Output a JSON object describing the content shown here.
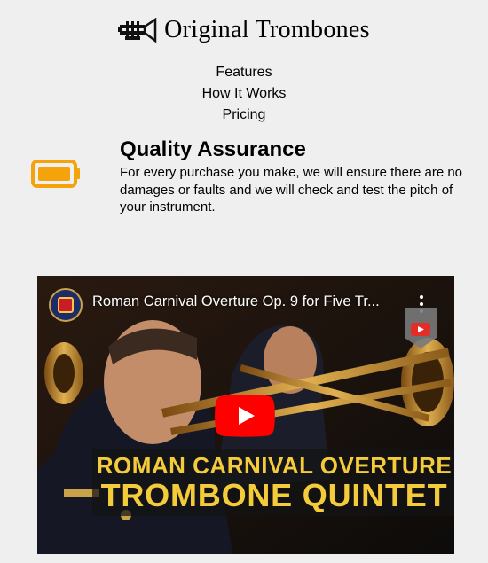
{
  "brand": {
    "name": "Original Trombones",
    "icon": "trumpet-icon"
  },
  "nav": {
    "items": [
      "Features",
      "How It Works",
      "Pricing"
    ]
  },
  "feature": {
    "icon": "battery-icon",
    "title": "Quality Assurance",
    "text": "For every purchase you make, we will ensure there are no damages or faults and we will check and test the pitch of your instrument."
  },
  "video": {
    "title": "Roman Carnival Overture Op. 9 for Five Tr...",
    "caption_line1": "ROMAN CARNIVAL OVERTURE",
    "caption_line2": "TROMBONE QUINTET",
    "play_icon": "play-icon",
    "menu_icon": "more-vert-icon",
    "watch_later_icon": "watch-later-icon"
  },
  "colors": {
    "background": "#efefef",
    "battery": "#f5a30a",
    "play": "#ff0000",
    "caption": "#f4cb3a"
  }
}
